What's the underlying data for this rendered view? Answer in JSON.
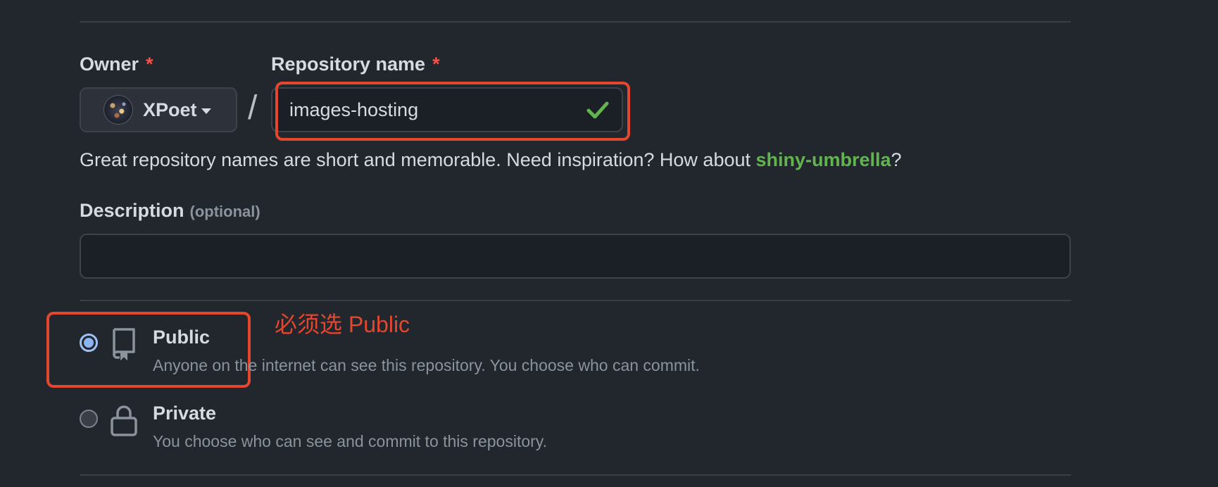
{
  "owner": {
    "label": "Owner",
    "required_mark": "*",
    "name": "XPoet"
  },
  "repository": {
    "label": "Repository name",
    "required_mark": "*",
    "separator": "/",
    "value": "images-hosting",
    "status_icon": "check-icon"
  },
  "hint": {
    "text": "Great repository names are short and memorable. Need inspiration? How about ",
    "suggestion": "shiny-umbrella",
    "suffix": "?"
  },
  "description": {
    "label": "Description",
    "optional": "(optional)",
    "value": ""
  },
  "visibility": {
    "options": [
      {
        "title": "Public",
        "description": "Anyone on the internet can see this repository. You choose who can commit.",
        "icon": "repo-icon",
        "checked": true
      },
      {
        "title": "Private",
        "description": "You choose who can see and commit to this repository.",
        "icon": "lock-icon",
        "checked": false
      }
    ]
  },
  "annotation": {
    "text": "必须选 Public"
  },
  "colors": {
    "background": "#22262d",
    "annotation_red": "#e5462e",
    "success_green": "#63b451",
    "radio_blue": "#8cb4f2"
  }
}
